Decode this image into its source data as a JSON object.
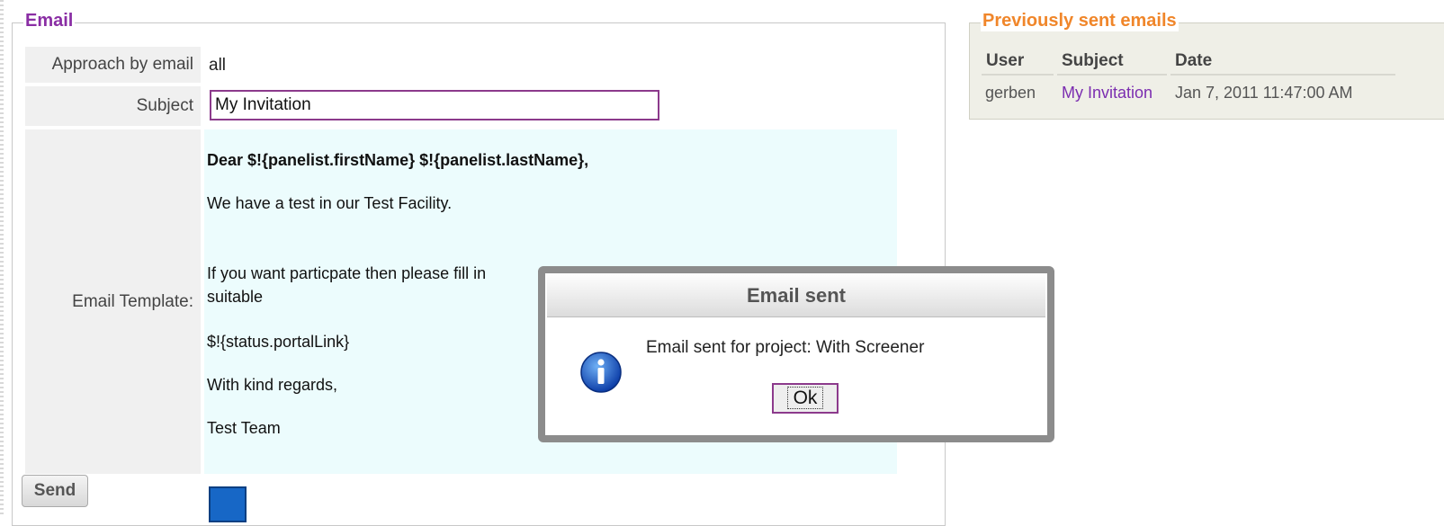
{
  "email_section": {
    "legend": "Email",
    "approach_label": "Approach by email",
    "approach_value": "all",
    "subject_label": "Subject",
    "subject_value": "My Invitation",
    "template_label": "Email Template:",
    "template_lines": [
      "Dear $!{panelist.firstName} $!{panelist.lastName},",
      "We have a test in our Test Facility.",
      "If you want particpate then please fill in",
      "suitable",
      "$!{status.portalLink}",
      "With kind regards,",
      "Test Team"
    ],
    "send_label": "Send"
  },
  "previous_emails": {
    "legend": "Previously sent emails",
    "columns": [
      "User",
      "Subject",
      "Date"
    ],
    "rows": [
      {
        "user": "gerben",
        "subject": "My Invitation",
        "date": "Jan 7, 2011 11:47:00 AM"
      }
    ]
  },
  "dialog": {
    "title": "Email sent",
    "message": "Email sent for project: With Screener",
    "ok_label": "Ok",
    "icon": "info-icon"
  },
  "colors": {
    "email_legend": "#8a2ea4",
    "previous_legend": "#f0862a",
    "link": "#7b2db0",
    "template_bg": "#ecfcfd",
    "accent_border": "#8c3a8c"
  }
}
